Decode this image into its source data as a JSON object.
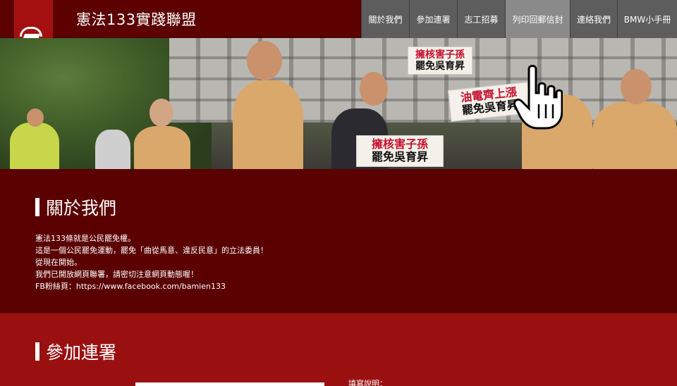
{
  "header": {
    "title": "憲法133實踐聯盟",
    "nav": [
      {
        "label": "關於我們",
        "active": false
      },
      {
        "label": "參加連署",
        "active": false
      },
      {
        "label": "志工招募",
        "active": false
      },
      {
        "label": "列印回郵信封",
        "active": true
      },
      {
        "label": "連絡我們",
        "active": false
      },
      {
        "label": "BMW小手冊",
        "active": false
      }
    ]
  },
  "hero": {
    "signs": [
      {
        "line1": "擁核害子孫",
        "line2": "罷免吳育昇"
      },
      {
        "line1": "油電齊上漲",
        "line2": "罷免吳育昇"
      },
      {
        "line1": "擁核害子孫",
        "line2": "罷免吳育昇"
      }
    ]
  },
  "about": {
    "title": "關於我們",
    "lines": [
      "憲法133條就是公民罷免權。",
      "這是一個公民罷免運動，罷免「曲從馬意、違反民意」的立法委員！",
      "從現在開始。",
      "我們已開放網頁聯署，請密切注意網頁動態喔！",
      "FB粉絲頁：https://www.facebook.com/bamien133"
    ]
  },
  "join": {
    "title": "參加連署",
    "hint": "填寫說明："
  },
  "colors": {
    "header_bg": "#5c0000",
    "nav_bg": "#5d5d5d",
    "nav_active_bg": "#8a8a8a",
    "about_bg": "#5a0000",
    "join_bg": "#9a1010",
    "logo_bg": "#a41010"
  }
}
